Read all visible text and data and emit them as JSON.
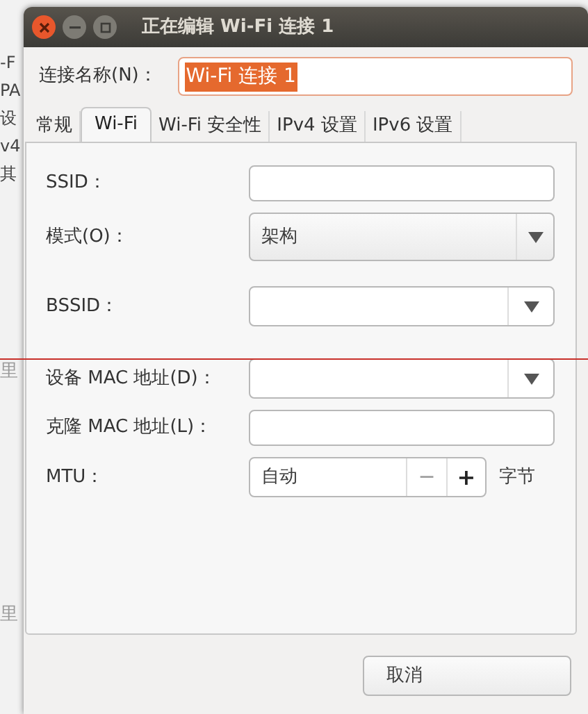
{
  "background_window": {
    "side_texts": [
      "-F",
      "PA",
      "设",
      "v4",
      "其"
    ],
    "lower_texts": [
      "里",
      "里"
    ]
  },
  "window": {
    "title": "正在编辑 Wi-Fi 连接 1"
  },
  "connection_name": {
    "label": "连接名称(N)：",
    "value": "Wi-Fi 连接 1",
    "text_selected": true
  },
  "tabs": [
    {
      "label": "常规",
      "selected": false
    },
    {
      "label": "Wi-Fi",
      "selected": true
    },
    {
      "label": "Wi-Fi 安全性",
      "selected": false
    },
    {
      "label": "IPv4 设置",
      "selected": false
    },
    {
      "label": "IPv6 设置",
      "selected": false
    }
  ],
  "fields": [
    {
      "kind": "text",
      "label": "SSID："
    },
    {
      "kind": "combo",
      "label": "模式(O)：",
      "value": "架构"
    },
    {
      "kind": "combo_entry",
      "label": "BSSID："
    },
    {
      "kind": "combo_entry",
      "label": "设备 MAC 地址(D)："
    },
    {
      "kind": "text",
      "label": "克隆 MAC 地址(L)："
    },
    {
      "kind": "spin",
      "label": "MTU：",
      "value": "自动",
      "minus": "−",
      "plus": "+",
      "unit": "字节"
    }
  ],
  "buttons": [
    "取消"
  ]
}
